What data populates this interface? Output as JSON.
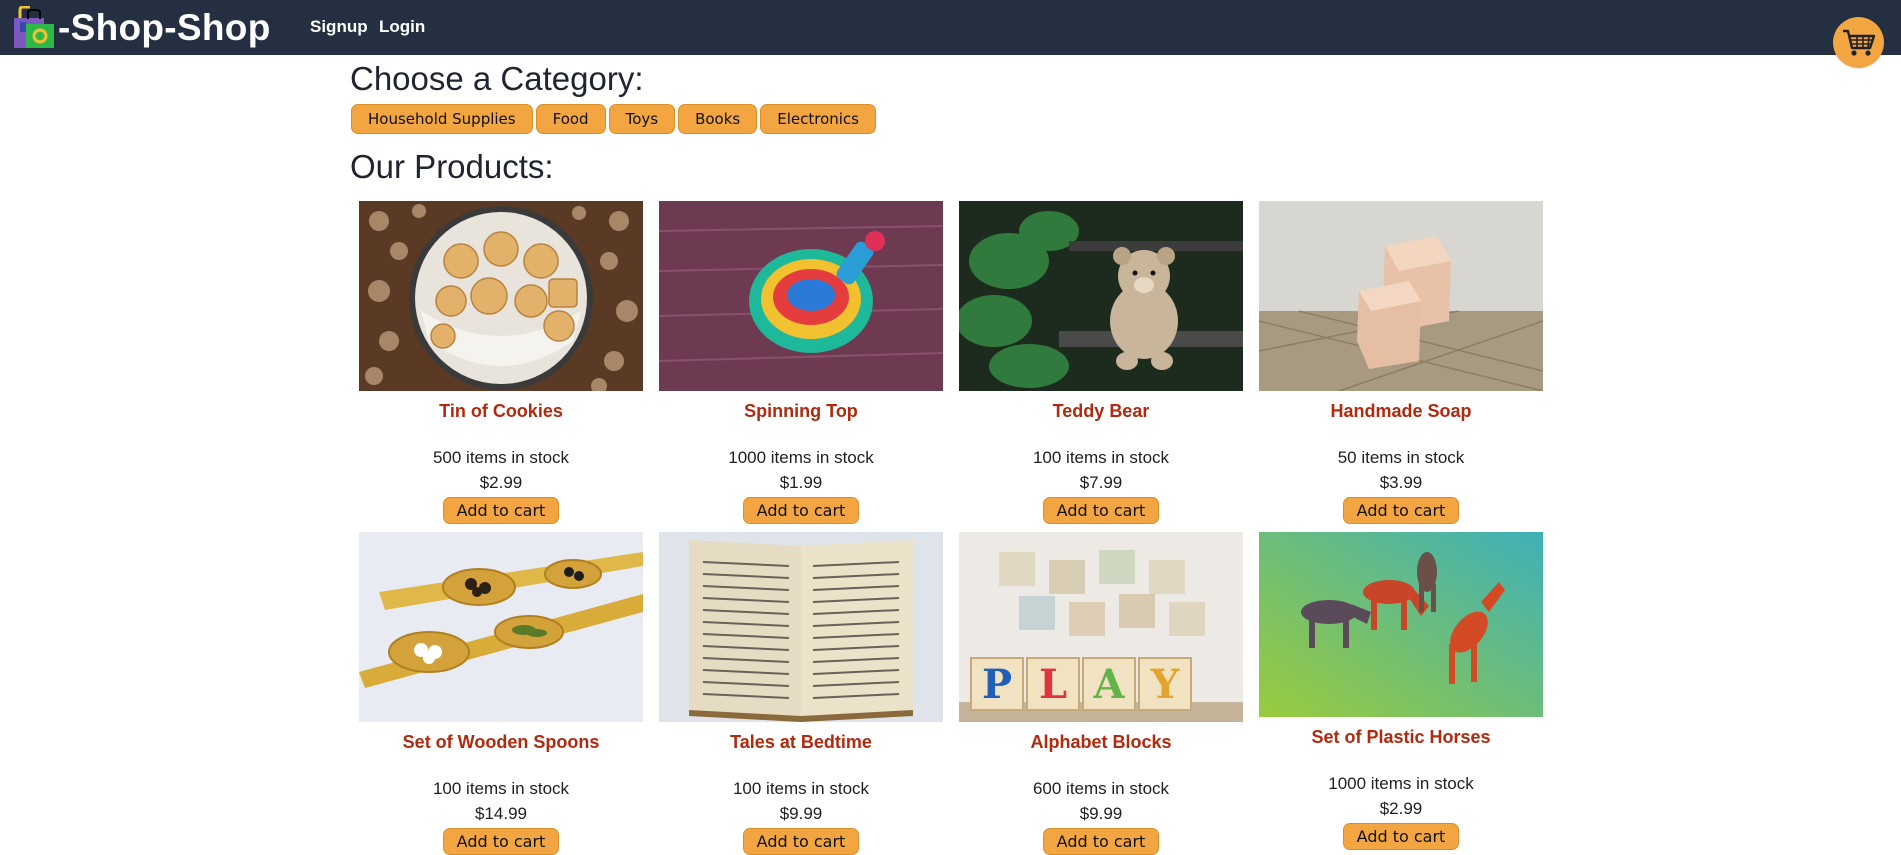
{
  "header": {
    "brand": "-Shop-Shop",
    "nav": [
      {
        "label": "Signup"
      },
      {
        "label": "Login"
      }
    ]
  },
  "categories": {
    "title": "Choose a Category:",
    "items": [
      "Household Supplies",
      "Food",
      "Toys",
      "Books",
      "Electronics"
    ]
  },
  "products": {
    "title": "Our Products:",
    "stock_suffix": "items in stock",
    "add_label": "Add to cart",
    "items": [
      {
        "name": "Tin of Cookies",
        "stock": "500 items in stock",
        "price": "$2.99",
        "image": "cookies-tin"
      },
      {
        "name": "Spinning Top",
        "stock": "1000 items in stock",
        "price": "$1.99",
        "image": "spinning-top"
      },
      {
        "name": "Teddy Bear",
        "stock": "100 items in stock",
        "price": "$7.99",
        "image": "teddy-bear"
      },
      {
        "name": "Handmade Soap",
        "stock": "50 items in stock",
        "price": "$3.99",
        "image": "soap-bars"
      },
      {
        "name": "Set of Wooden Spoons",
        "stock": "100 items in stock",
        "price": "$14.99",
        "image": "wooden-spoons"
      },
      {
        "name": "Tales at Bedtime",
        "stock": "100 items in stock",
        "price": "$9.99",
        "image": "open-book"
      },
      {
        "name": "Alphabet Blocks",
        "stock": "600 items in stock",
        "price": "$9.99",
        "image": "play-blocks"
      },
      {
        "name": "Set of Plastic Horses",
        "stock": "1000 items in stock",
        "price": "$2.99",
        "image": "plastic-horses"
      }
    ]
  },
  "colors": {
    "navbar": "#243041",
    "accent": "#f2a541",
    "product_name": "#b2290e"
  },
  "icons": {
    "brand": "shopping-bag-icon",
    "cart": "shopping-cart-icon"
  }
}
